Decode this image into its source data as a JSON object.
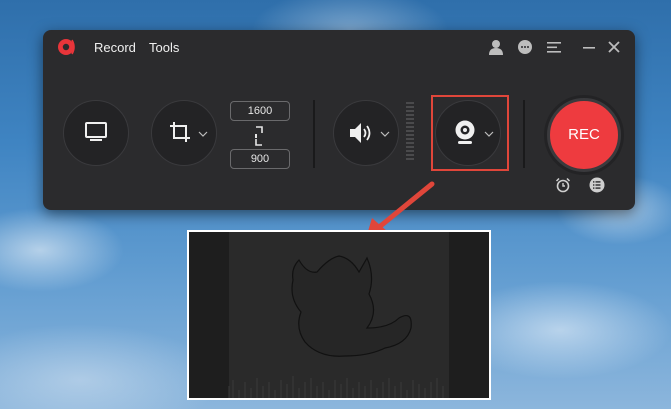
{
  "menu": {
    "record": "Record",
    "tools": "Tools"
  },
  "titlebar_icons": [
    "user-icon",
    "chat-icon",
    "menu-icon",
    "minimize-icon",
    "close-icon"
  ],
  "controls": {
    "width_value": "1600",
    "height_value": "900",
    "rec_label": "REC",
    "bottom_icons": [
      "alarm-clock-icon",
      "task-list-icon"
    ]
  },
  "colors": {
    "rec": "#ee3b3f",
    "highlight": "#e0463a",
    "accent_logo": "#e8353a",
    "panel": "#2b2b2d"
  }
}
